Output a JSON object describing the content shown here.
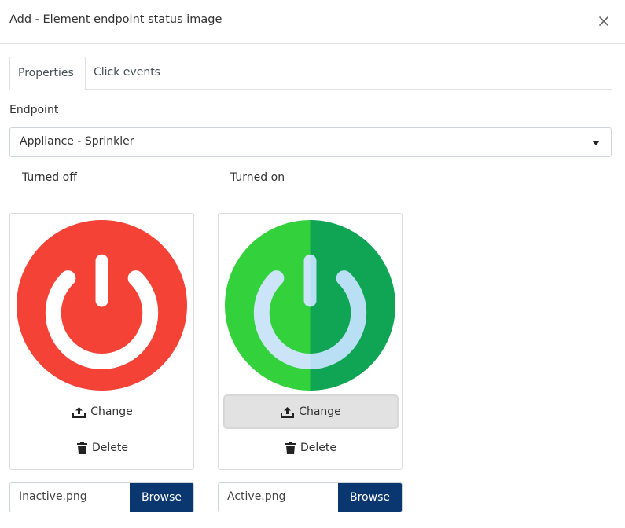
{
  "modal": {
    "title": "Add - Element endpoint status image",
    "close_icon": "close-icon"
  },
  "tabs": [
    {
      "label": "Properties",
      "active": true
    },
    {
      "label": "Click events",
      "active": false
    }
  ],
  "endpoint": {
    "label": "Endpoint",
    "selected": "Appliance - Sprinkler"
  },
  "images": [
    {
      "label": "Turned off",
      "icon": "power-off-red-icon",
      "change_label": "Change",
      "delete_label": "Delete",
      "file_name": "Inactive.png",
      "browse_label": "Browse",
      "colors": {
        "circle": "#f44336",
        "symbol": "#ffffff"
      }
    },
    {
      "label": "Turned on",
      "icon": "power-on-green-icon",
      "change_label": "Change",
      "delete_label": "Delete",
      "file_name": "Active.png",
      "browse_label": "Browse",
      "colors": {
        "circle_left": "#33d13c",
        "circle_right": "#10a555",
        "symbol_left": "#cbe4f7",
        "symbol_right": "#b8dff3"
      }
    }
  ],
  "colors": {
    "browse_button": "#0b3770",
    "hover_button": "#e2e2e2"
  }
}
